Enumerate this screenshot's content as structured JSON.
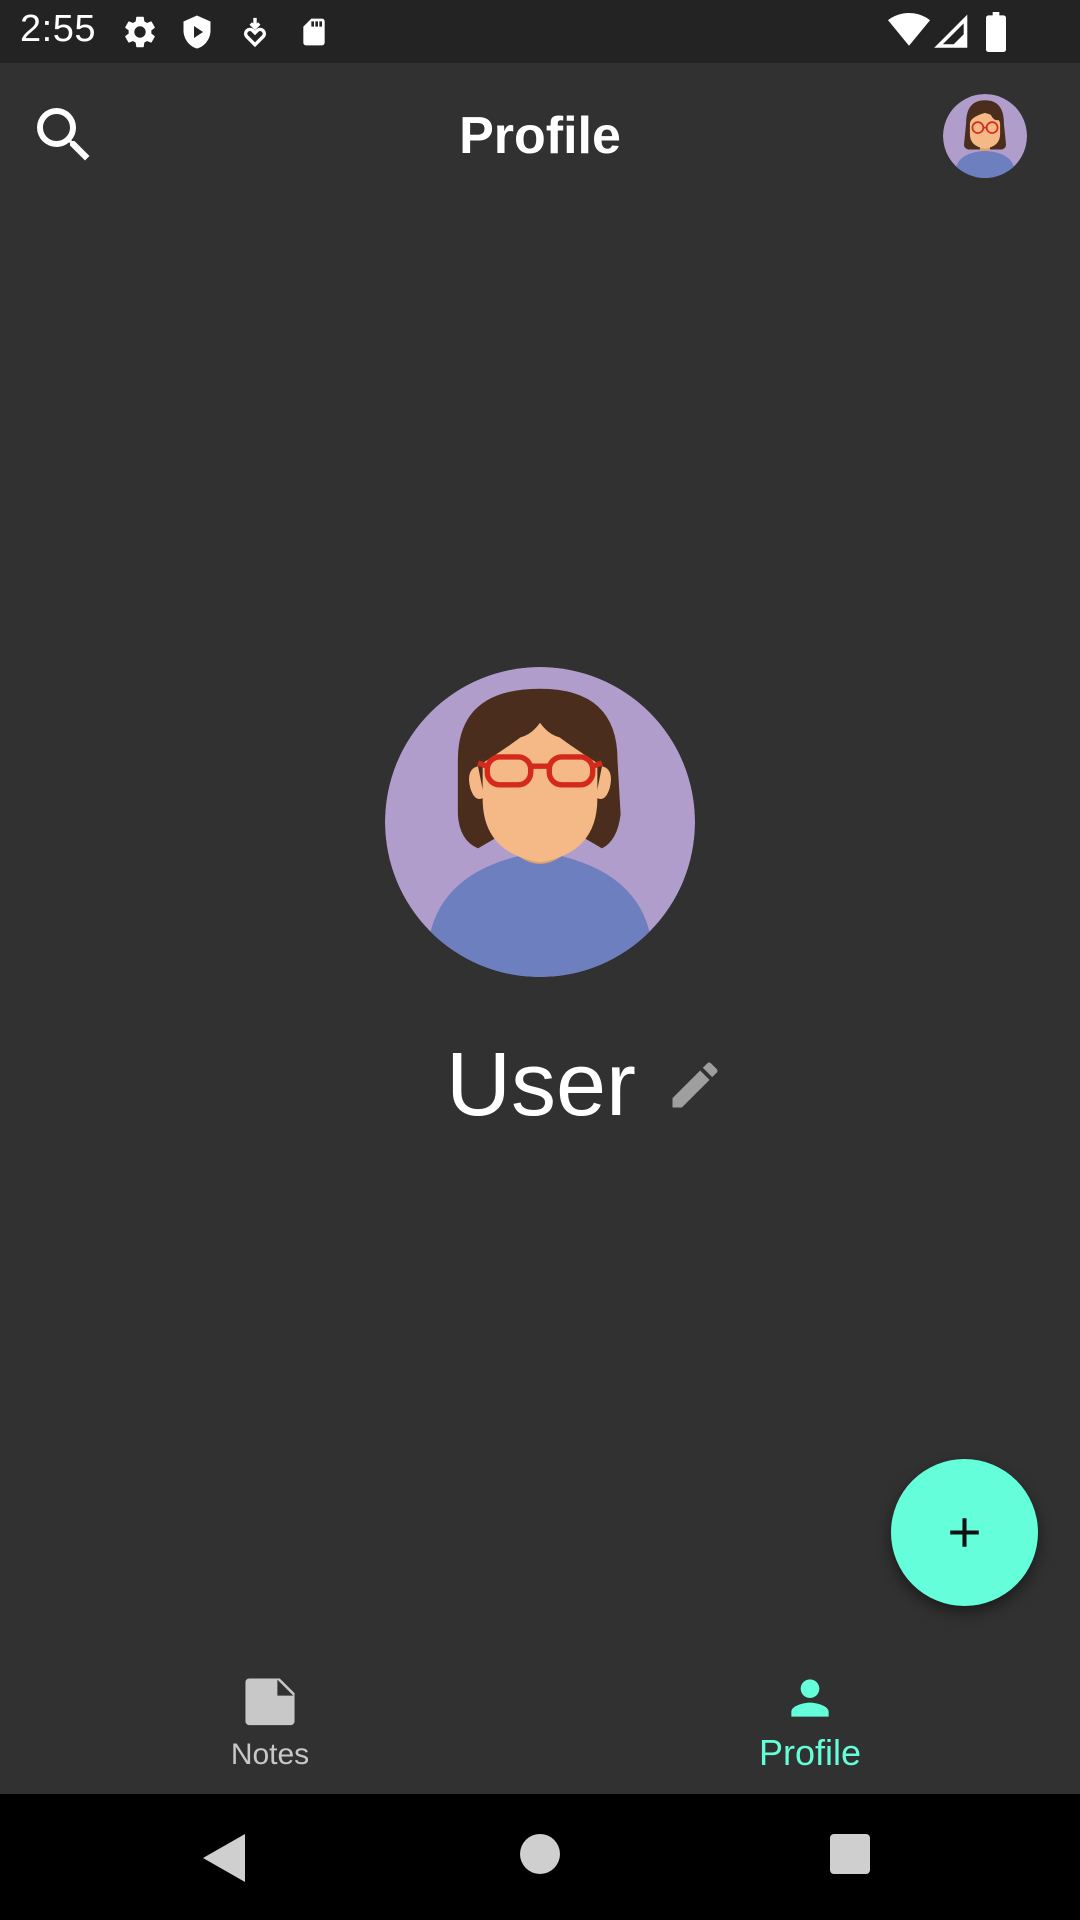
{
  "status_bar": {
    "time": "2:55",
    "left_icons": [
      "gear-icon",
      "shield-play-icon",
      "download-heart-icon",
      "sd-card-icon"
    ],
    "right_icons": [
      "wifi-icon",
      "signal-icon",
      "battery-icon"
    ]
  },
  "app_bar": {
    "title": "Profile",
    "search_icon": "search-icon",
    "avatar": "user-avatar"
  },
  "profile": {
    "name": "User",
    "edit_icon": "pencil-icon"
  },
  "fab": {
    "icon": "plus-icon"
  },
  "bottom_nav": {
    "items": [
      {
        "label": "Notes",
        "icon": "note-icon",
        "selected": false
      },
      {
        "label": "Profile",
        "icon": "person-icon",
        "selected": true
      }
    ]
  },
  "system_nav": {
    "buttons": [
      "back-icon",
      "home-icon",
      "recents-icon"
    ]
  },
  "colors": {
    "background": "#313131",
    "status_bar": "#232323",
    "accent": "#64ffda",
    "avatar_bg": "#b19dcc",
    "shirt": "#6e7fbf",
    "hair": "#4a2d1d",
    "skin": "#f4b986",
    "glasses": "#d42a1c"
  }
}
